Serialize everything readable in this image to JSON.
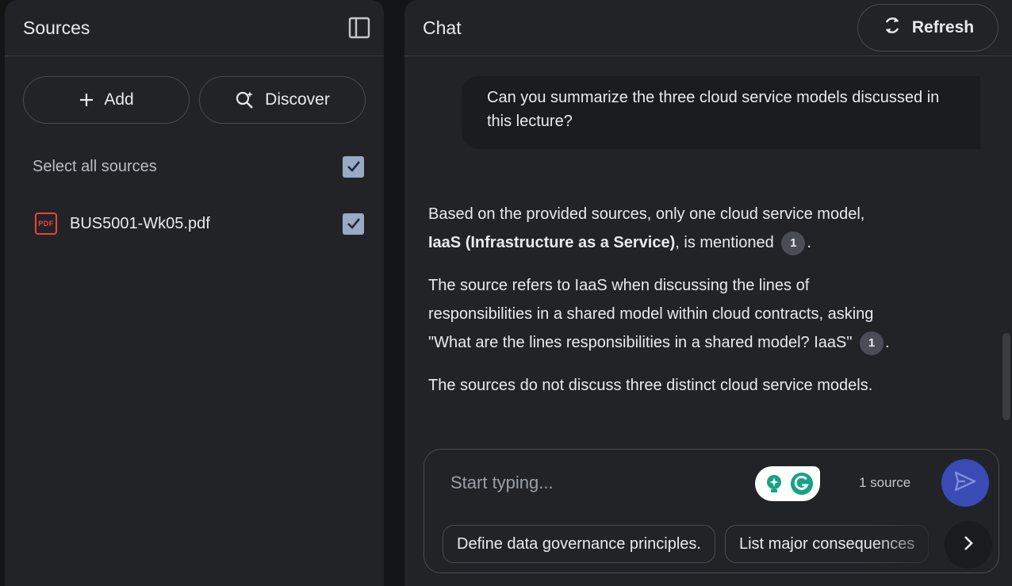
{
  "sources": {
    "title": "Sources",
    "add_label": "Add",
    "discover_label": "Discover",
    "select_all_label": "Select all sources",
    "items": [
      {
        "name": "BUS5001-Wk05.pdf",
        "type_badge": "PDF",
        "checked": true
      }
    ]
  },
  "chat": {
    "title": "Chat",
    "refresh_label": "Refresh",
    "user_message": "Can you summarize the three cloud service models discussed in this lecture?",
    "answer": {
      "p1_lead": "Based on the provided sources, only one cloud service model,",
      "p1_bold": "IaaS (Infrastructure as a Service)",
      "p1_tail": ", is mentioned",
      "p1_cite": "1",
      "p1_end": ".",
      "p2_text": "The source refers to IaaS when discussing the lines of responsibilities in a shared model within cloud contracts, asking \"What are the lines responsibilities in a shared model? IaaS\"",
      "p2_cite": "1",
      "p2_end": ".",
      "p3_text": "The sources do not discuss three distinct cloud service models."
    },
    "composer": {
      "placeholder": "Start typing...",
      "source_count": "1 source"
    },
    "suggestions": [
      "Define data governance principles.",
      "List major consequences"
    ]
  },
  "colors": {
    "panel_bg": "#222327",
    "page_bg": "#131416",
    "send_button": "#3a4bb5",
    "pdf_red": "#e8453c",
    "checkbox": "#9aa9c4",
    "grammarly_green": "#15a383"
  }
}
